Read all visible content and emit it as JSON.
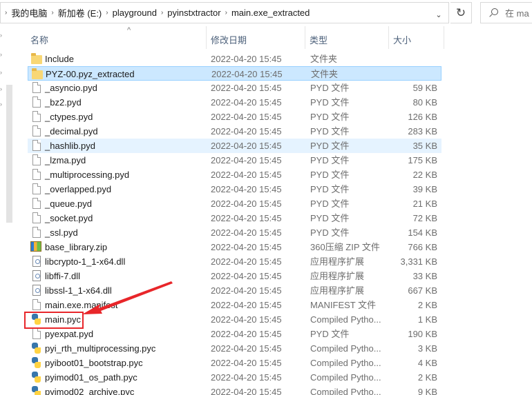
{
  "address": {
    "crumbs": [
      "我的电脑",
      "新加卷 (E:)",
      "playground",
      "pyinstxtractor",
      "main.exe_extracted"
    ],
    "dropdown_icon": "chevron-down-icon",
    "refresh_icon": "refresh-icon"
  },
  "search": {
    "placeholder": "在 ma"
  },
  "columns": {
    "name": "名称",
    "date": "修改日期",
    "type": "类型",
    "size": "大小"
  },
  "files": [
    {
      "name": "Include",
      "date": "2022-04-20 15:45",
      "type": "文件夹",
      "size": "",
      "icon": "folder-icon",
      "state": ""
    },
    {
      "name": "PYZ-00.pyz_extracted",
      "date": "2022-04-20 15:45",
      "type": "文件夹",
      "size": "",
      "icon": "folder-icon",
      "state": "selected"
    },
    {
      "name": "_asyncio.pyd",
      "date": "2022-04-20 15:45",
      "type": "PYD 文件",
      "size": "59 KB",
      "icon": "file-icon",
      "state": ""
    },
    {
      "name": "_bz2.pyd",
      "date": "2022-04-20 15:45",
      "type": "PYD 文件",
      "size": "80 KB",
      "icon": "file-icon",
      "state": ""
    },
    {
      "name": "_ctypes.pyd",
      "date": "2022-04-20 15:45",
      "type": "PYD 文件",
      "size": "126 KB",
      "icon": "file-icon",
      "state": ""
    },
    {
      "name": "_decimal.pyd",
      "date": "2022-04-20 15:45",
      "type": "PYD 文件",
      "size": "283 KB",
      "icon": "file-icon",
      "state": ""
    },
    {
      "name": "_hashlib.pyd",
      "date": "2022-04-20 15:45",
      "type": "PYD 文件",
      "size": "35 KB",
      "icon": "file-icon",
      "state": "hover"
    },
    {
      "name": "_lzma.pyd",
      "date": "2022-04-20 15:45",
      "type": "PYD 文件",
      "size": "175 KB",
      "icon": "file-icon",
      "state": ""
    },
    {
      "name": "_multiprocessing.pyd",
      "date": "2022-04-20 15:45",
      "type": "PYD 文件",
      "size": "22 KB",
      "icon": "file-icon",
      "state": ""
    },
    {
      "name": "_overlapped.pyd",
      "date": "2022-04-20 15:45",
      "type": "PYD 文件",
      "size": "39 KB",
      "icon": "file-icon",
      "state": ""
    },
    {
      "name": "_queue.pyd",
      "date": "2022-04-20 15:45",
      "type": "PYD 文件",
      "size": "21 KB",
      "icon": "file-icon",
      "state": ""
    },
    {
      "name": "_socket.pyd",
      "date": "2022-04-20 15:45",
      "type": "PYD 文件",
      "size": "72 KB",
      "icon": "file-icon",
      "state": ""
    },
    {
      "name": "_ssl.pyd",
      "date": "2022-04-20 15:45",
      "type": "PYD 文件",
      "size": "154 KB",
      "icon": "file-icon",
      "state": ""
    },
    {
      "name": "base_library.zip",
      "date": "2022-04-20 15:45",
      "type": "360压缩 ZIP 文件",
      "size": "766 KB",
      "icon": "zip-archive-icon",
      "state": ""
    },
    {
      "name": "libcrypto-1_1-x64.dll",
      "date": "2022-04-20 15:45",
      "type": "应用程序扩展",
      "size": "3,331 KB",
      "icon": "dll-file-icon",
      "state": ""
    },
    {
      "name": "libffi-7.dll",
      "date": "2022-04-20 15:45",
      "type": "应用程序扩展",
      "size": "33 KB",
      "icon": "dll-file-icon",
      "state": ""
    },
    {
      "name": "libssl-1_1-x64.dll",
      "date": "2022-04-20 15:45",
      "type": "应用程序扩展",
      "size": "667 KB",
      "icon": "dll-file-icon",
      "state": ""
    },
    {
      "name": "main.exe.manifest",
      "date": "2022-04-20 15:45",
      "type": "MANIFEST 文件",
      "size": "2 KB",
      "icon": "file-icon",
      "state": ""
    },
    {
      "name": "main.pyc",
      "date": "2022-04-20 15:45",
      "type": "Compiled Pytho...",
      "size": "1 KB",
      "icon": "python-file-icon",
      "state": "highlighted"
    },
    {
      "name": "pyexpat.pyd",
      "date": "2022-04-20 15:45",
      "type": "PYD 文件",
      "size": "190 KB",
      "icon": "file-icon",
      "state": ""
    },
    {
      "name": "pyi_rth_multiprocessing.pyc",
      "date": "2022-04-20 15:45",
      "type": "Compiled Pytho...",
      "size": "3 KB",
      "icon": "python-file-icon",
      "state": ""
    },
    {
      "name": "pyiboot01_bootstrap.pyc",
      "date": "2022-04-20 15:45",
      "type": "Compiled Pytho...",
      "size": "4 KB",
      "icon": "python-file-icon",
      "state": ""
    },
    {
      "name": "pyimod01_os_path.pyc",
      "date": "2022-04-20 15:45",
      "type": "Compiled Pytho...",
      "size": "2 KB",
      "icon": "python-file-icon",
      "state": ""
    },
    {
      "name": "pyimod02_archive.pyc",
      "date": "2022-04-20 15:45",
      "type": "Compiled Pytho...",
      "size": "9 KB",
      "icon": "python-file-icon",
      "state": ""
    }
  ],
  "annotation": {
    "color": "#e8262a"
  }
}
